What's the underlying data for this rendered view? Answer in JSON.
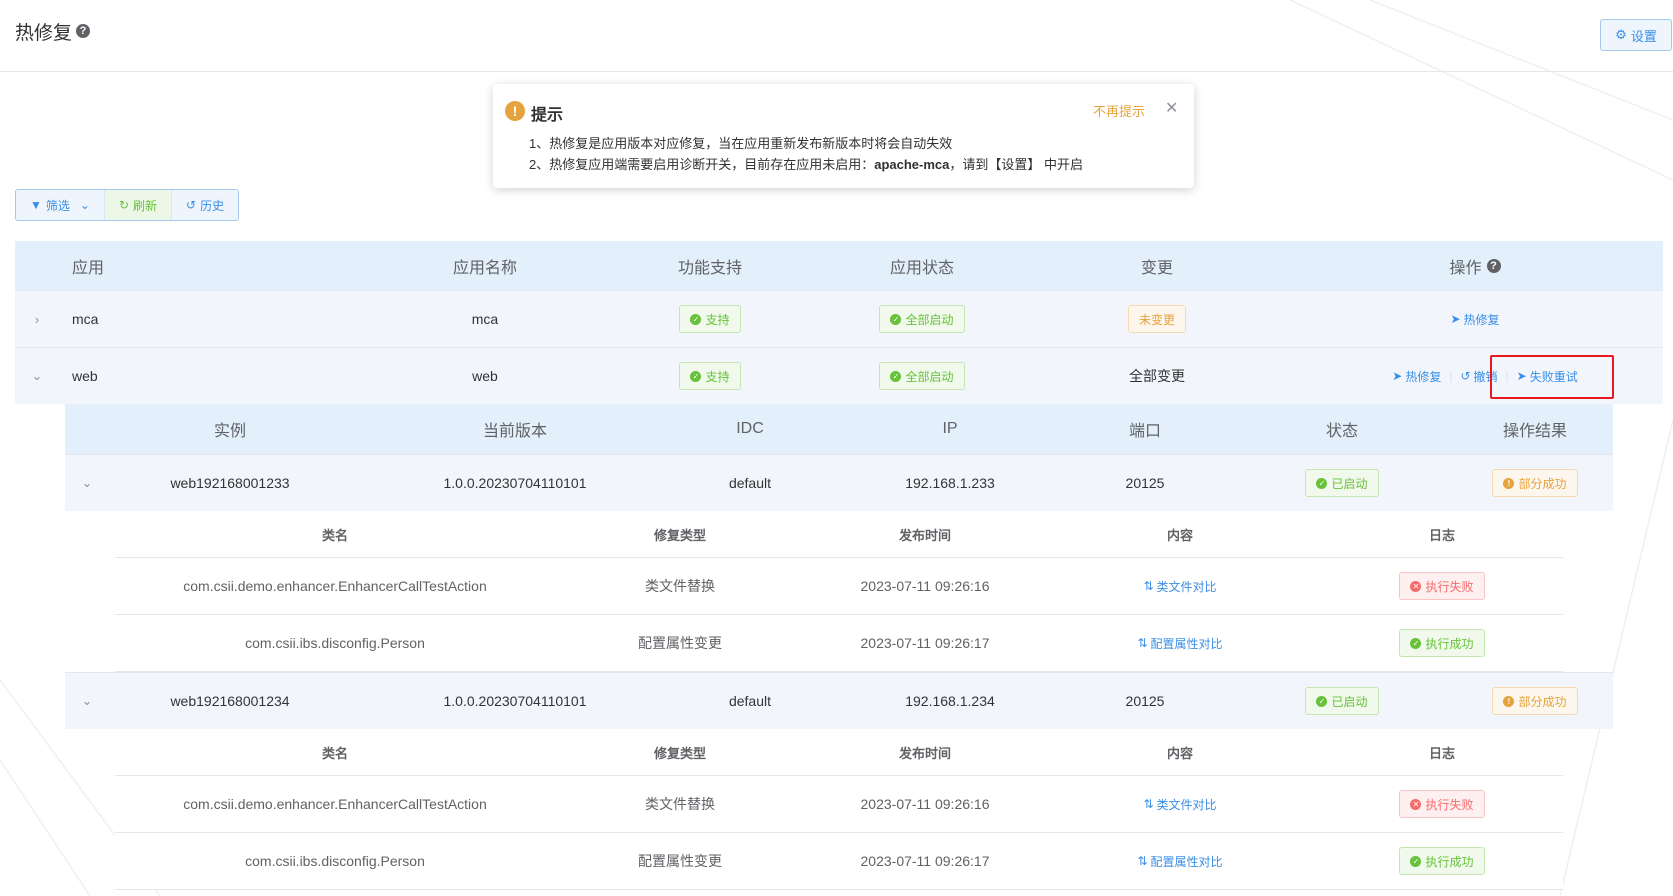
{
  "page": {
    "title": "热修复",
    "settings_label": "设置"
  },
  "notice": {
    "title": "提示",
    "dismiss_label": "不再提示",
    "line1": "1、热修复是应用版本对应修复，当在应用重新发布新版本时将会自动失效",
    "line2_prefix": "2、热修复应用端需要启用诊断开关，目前存在应用未启用：",
    "line2_app": "apache-mca",
    "line2_suffix": "，请到【设置】 中开启"
  },
  "toolbar": {
    "filter_label": "筛选",
    "refresh_label": "刷新",
    "history_label": "历史"
  },
  "main_table": {
    "headers": [
      "应用",
      "应用名称",
      "功能支持",
      "应用状态",
      "变更",
      "操作"
    ],
    "rows": [
      {
        "app": "mca",
        "name": "mca",
        "support": "支持",
        "status": "全部启动",
        "change": "未变更",
        "actions": [
          "热修复"
        ]
      },
      {
        "app": "web",
        "name": "web",
        "support": "支持",
        "status": "全部启动",
        "change": "全部变更",
        "actions": [
          "热修复",
          "撤销",
          "失败重试"
        ]
      }
    ]
  },
  "instance_table": {
    "headers": [
      "实例",
      "当前版本",
      "IDC",
      "IP",
      "端口",
      "状态",
      "操作结果"
    ],
    "sub_headers": [
      "类名",
      "修复类型",
      "发布时间",
      "内容",
      "日志"
    ],
    "instances": [
      {
        "instance": "web192168001233",
        "version": "1.0.0.20230704110101",
        "idc": "default",
        "ip": "192.168.1.233",
        "port": "20125",
        "status": "已启动",
        "result": "部分成功",
        "fixes": [
          {
            "class": "com.csii.demo.enhancer.EnhancerCallTestAction",
            "type": "类文件替换",
            "time": "2023-07-11 09:26:16",
            "content": "类文件对比",
            "log": "执行失败"
          },
          {
            "class": "com.csii.ibs.disconfig.Person",
            "type": "配置属性变更",
            "time": "2023-07-11 09:26:17",
            "content": "配置属性对比",
            "log": "执行成功"
          }
        ]
      },
      {
        "instance": "web192168001234",
        "version": "1.0.0.20230704110101",
        "idc": "default",
        "ip": "192.168.1.234",
        "port": "20125",
        "status": "已启动",
        "result": "部分成功",
        "fixes": [
          {
            "class": "com.csii.demo.enhancer.EnhancerCallTestAction",
            "type": "类文件替换",
            "time": "2023-07-11 09:26:16",
            "content": "类文件对比",
            "log": "执行失败"
          },
          {
            "class": "com.csii.ibs.disconfig.Person",
            "type": "配置属性变更",
            "time": "2023-07-11 09:26:17",
            "content": "配置属性对比",
            "log": "执行成功"
          }
        ]
      }
    ]
  },
  "colors": {
    "primary": "#3a8ee6",
    "success": "#67c23a",
    "warning": "#e6a23c",
    "danger": "#f56c6c",
    "highlight": "#e8191d"
  }
}
